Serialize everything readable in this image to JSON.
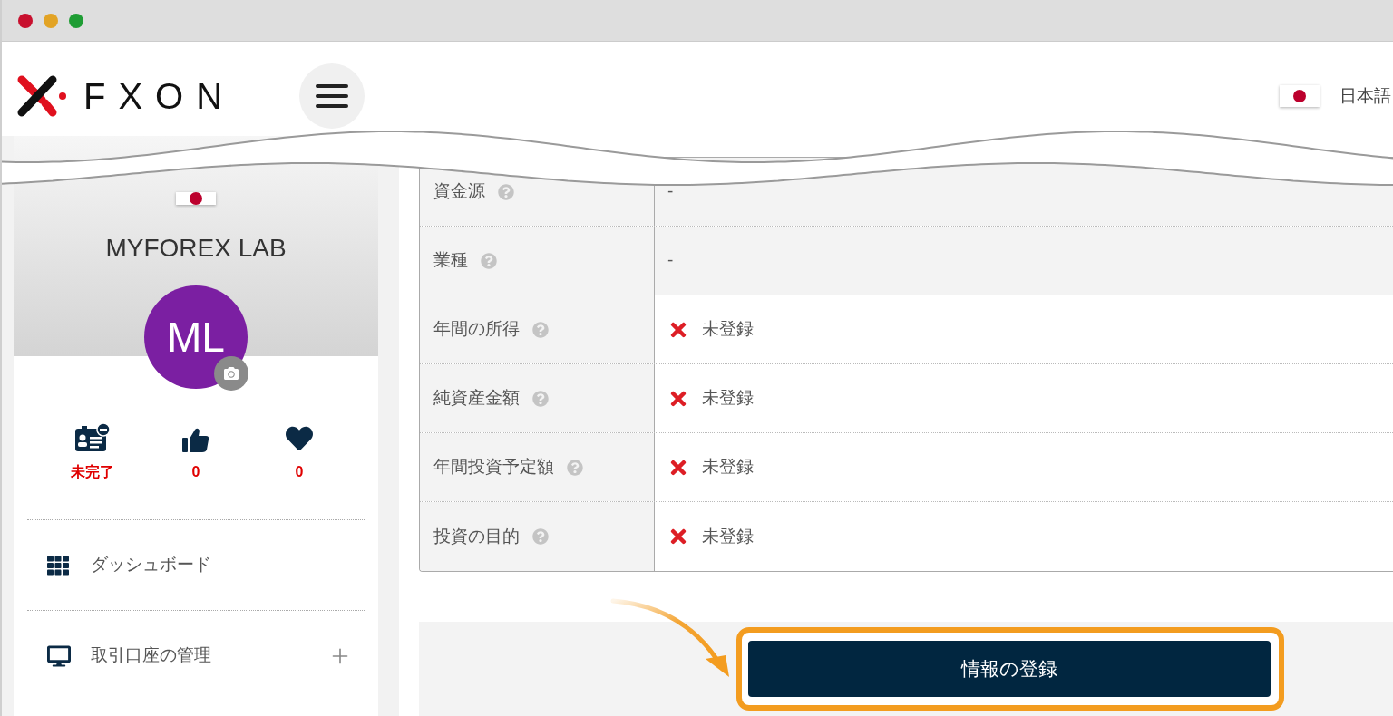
{
  "header": {
    "logo_text": "FXON",
    "language": {
      "label": "日本語"
    }
  },
  "sidebar": {
    "profile": {
      "name": "MYFOREX LAB",
      "initials": "ML"
    },
    "stats": [
      {
        "kind": "id-card",
        "value": "未完了",
        "color": "#e00000"
      },
      {
        "kind": "like",
        "value": "0",
        "color": "#e00000"
      },
      {
        "kind": "favorite",
        "value": "0",
        "color": "#e00000"
      }
    ],
    "menu": [
      {
        "kind": "grid",
        "label": "ダッシュボード",
        "expandable": false
      },
      {
        "kind": "monitor",
        "label": "取引口座の管理",
        "expandable": true
      }
    ]
  },
  "table": {
    "rows": [
      {
        "label": "資金源",
        "kind": "text",
        "value": "-"
      },
      {
        "label": "業種",
        "kind": "text",
        "value": "-"
      },
      {
        "label": "年間の所得",
        "kind": "missing",
        "value": "未登録"
      },
      {
        "label": "純資産金額",
        "kind": "missing",
        "value": "未登録"
      },
      {
        "label": "年間投資予定額",
        "kind": "missing",
        "value": "未登録"
      },
      {
        "label": "投資の目的",
        "kind": "missing",
        "value": "未登録"
      }
    ]
  },
  "submit_button": {
    "label": "情報の登録"
  }
}
